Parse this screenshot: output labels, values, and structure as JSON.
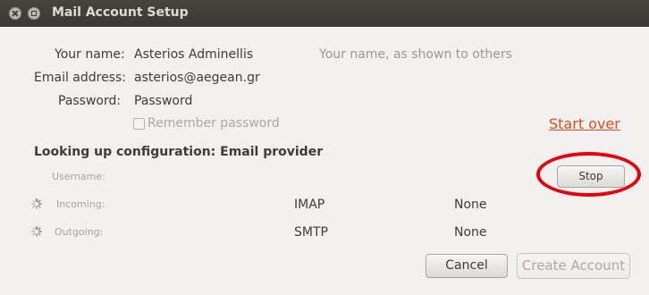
{
  "window": {
    "title": "Mail Account Setup"
  },
  "form": {
    "name_label": "Your name:",
    "name_value": "Asterios Adminellis",
    "name_hint": "Your name, as shown to others",
    "email_label": "Email address:",
    "email_value": "asterios@aegean.gr",
    "password_label": "Password:",
    "password_value": "Password",
    "remember_label": "Remember password",
    "remember_checked": false,
    "start_over": "Start over"
  },
  "config": {
    "heading": "Looking up configuration: Email provider",
    "username_label": "Username:",
    "incoming_label": "Incoming:",
    "incoming_protocol": "IMAP",
    "incoming_security": "None",
    "outgoing_label": "Outgoing:",
    "outgoing_protocol": "SMTP",
    "outgoing_security": "None",
    "stop_button": "Stop"
  },
  "buttons": {
    "cancel": "Cancel",
    "create_account": "Create Account"
  },
  "colors": {
    "link": "#e04d1d",
    "annotation_ring": "#e4000d",
    "titlebar": "#3c3b37"
  }
}
